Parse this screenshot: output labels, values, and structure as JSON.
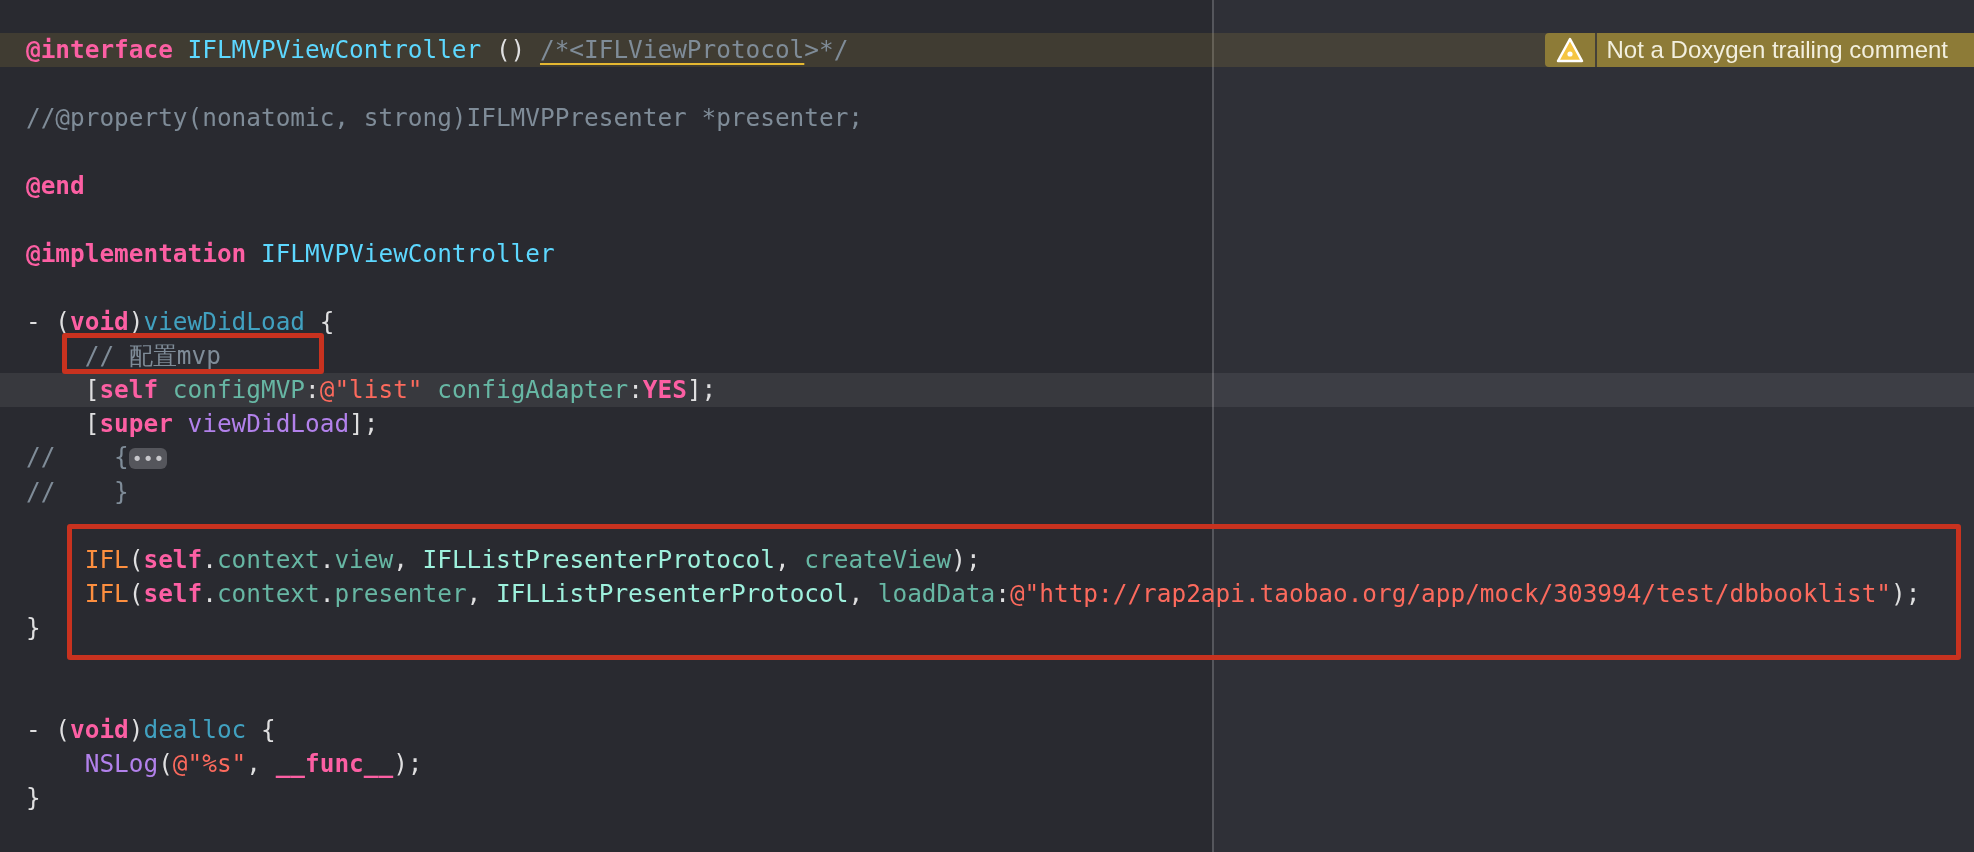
{
  "editor": {
    "lines": [
      {
        "kind": "code",
        "current": false,
        "framed": false,
        "issue": {
          "kind": "warning",
          "message": "Not a Doxygen trailing comment"
        },
        "tokens": [
          {
            "kind": "keyword",
            "text": "@interface"
          },
          {
            "kind": "class_decl",
            "text": " IFLMVPViewController"
          },
          {
            "kind": "plain",
            "text": " () "
          },
          {
            "kind": "warn_comment",
            "text": "/*<IFLViewProtocol"
          },
          {
            "kind": "comment",
            "text": ">*/"
          }
        ]
      },
      {
        "kind": "blank",
        "current": false,
        "framed": false
      },
      {
        "kind": "code",
        "current": false,
        "framed": false,
        "tokens": [
          {
            "kind": "comment",
            "text": "//@property(nonatomic, strong)IFLMVPPresenter *presenter;"
          }
        ]
      },
      {
        "kind": "blank",
        "current": false,
        "framed": false
      },
      {
        "kind": "code",
        "current": false,
        "framed": false,
        "tokens": [
          {
            "kind": "keyword",
            "text": "@end"
          }
        ]
      },
      {
        "kind": "blank",
        "current": false,
        "framed": false
      },
      {
        "kind": "code",
        "current": false,
        "framed": false,
        "tokens": [
          {
            "kind": "keyword",
            "text": "@implementation"
          },
          {
            "kind": "class_decl",
            "text": " IFLMVPViewController"
          }
        ]
      },
      {
        "kind": "blank",
        "current": false,
        "framed": false
      },
      {
        "kind": "code",
        "current": false,
        "framed": false,
        "tokens": [
          {
            "kind": "plain",
            "text": "- ("
          },
          {
            "kind": "keyword",
            "text": "void"
          },
          {
            "kind": "plain",
            "text": ")"
          },
          {
            "kind": "method_decl",
            "text": "viewDidLoad"
          },
          {
            "kind": "plain",
            "text": " {"
          }
        ]
      },
      {
        "kind": "code",
        "current": false,
        "framed": true,
        "tokens": [
          {
            "kind": "comment",
            "text": "    // 配置mvp"
          }
        ]
      },
      {
        "kind": "code",
        "current": true,
        "framed": false,
        "tokens": [
          {
            "kind": "plain",
            "text": "    ["
          },
          {
            "kind": "keyword",
            "text": "self"
          },
          {
            "kind": "method",
            "text": " configMVP"
          },
          {
            "kind": "plain",
            "text": ":"
          },
          {
            "kind": "string",
            "text": "@\"list\""
          },
          {
            "kind": "method",
            "text": " configAdapter"
          },
          {
            "kind": "plain",
            "text": ":"
          },
          {
            "kind": "keyword",
            "text": "YES"
          },
          {
            "kind": "plain",
            "text": "];"
          }
        ]
      },
      {
        "kind": "code",
        "current": false,
        "framed": false,
        "tokens": [
          {
            "kind": "plain",
            "text": "    ["
          },
          {
            "kind": "keyword",
            "text": "super"
          },
          {
            "kind": "sys_method",
            "text": " viewDidLoad"
          },
          {
            "kind": "plain",
            "text": "];"
          }
        ]
      },
      {
        "kind": "code",
        "current": false,
        "framed": false,
        "tokens": [
          {
            "kind": "comment",
            "text": "//    {"
          },
          {
            "kind": "fold",
            "text": "•••"
          }
        ]
      },
      {
        "kind": "code",
        "current": false,
        "framed": false,
        "tokens": [
          {
            "kind": "comment",
            "text": "//    }"
          }
        ]
      },
      {
        "kind": "blank",
        "current": false,
        "framed": false
      },
      {
        "kind": "code",
        "current": false,
        "framed": true,
        "tokens": [
          {
            "kind": "macro",
            "text": "    IFL"
          },
          {
            "kind": "plain",
            "text": "("
          },
          {
            "kind": "keyword",
            "text": "self"
          },
          {
            "kind": "plain",
            "text": "."
          },
          {
            "kind": "method",
            "text": "context"
          },
          {
            "kind": "plain",
            "text": "."
          },
          {
            "kind": "method",
            "text": "view"
          },
          {
            "kind": "plain",
            "text": ", "
          },
          {
            "kind": "type",
            "text": "IFLListPresenterProtocol"
          },
          {
            "kind": "plain",
            "text": ", "
          },
          {
            "kind": "method",
            "text": "createView"
          },
          {
            "kind": "plain",
            "text": ");"
          }
        ]
      },
      {
        "kind": "code",
        "current": false,
        "framed": true,
        "tokens": [
          {
            "kind": "macro",
            "text": "    IFL"
          },
          {
            "kind": "plain",
            "text": "("
          },
          {
            "kind": "keyword",
            "text": "self"
          },
          {
            "kind": "plain",
            "text": "."
          },
          {
            "kind": "method",
            "text": "context"
          },
          {
            "kind": "plain",
            "text": "."
          },
          {
            "kind": "method",
            "text": "presenter"
          },
          {
            "kind": "plain",
            "text": ", "
          },
          {
            "kind": "type",
            "text": "IFLListPresenterProtocol"
          },
          {
            "kind": "plain",
            "text": ", "
          },
          {
            "kind": "method",
            "text": "loadData"
          },
          {
            "kind": "plain",
            "text": ":"
          },
          {
            "kind": "string",
            "text": "@\"http://rap2api.taobao.org/app/mock/303994/test/dbbooklist\""
          },
          {
            "kind": "plain",
            "text": ");"
          }
        ]
      },
      {
        "kind": "code",
        "current": false,
        "framed": true,
        "tokens": [
          {
            "kind": "plain",
            "text": "}"
          }
        ]
      },
      {
        "kind": "blank",
        "current": false,
        "framed": false
      },
      {
        "kind": "blank",
        "current": false,
        "framed": false
      },
      {
        "kind": "code",
        "current": false,
        "framed": false,
        "tokens": [
          {
            "kind": "plain",
            "text": "- ("
          },
          {
            "kind": "keyword",
            "text": "void"
          },
          {
            "kind": "plain",
            "text": ")"
          },
          {
            "kind": "method_decl",
            "text": "dealloc"
          },
          {
            "kind": "plain",
            "text": " {"
          }
        ]
      },
      {
        "kind": "code",
        "current": false,
        "framed": false,
        "tokens": [
          {
            "kind": "sys_method",
            "text": "    NSLog"
          },
          {
            "kind": "plain",
            "text": "("
          },
          {
            "kind": "string",
            "text": "@\"%s\""
          },
          {
            "kind": "plain",
            "text": ", "
          },
          {
            "kind": "keyword",
            "text": "__func__"
          },
          {
            "kind": "plain",
            "text": ");"
          }
        ]
      },
      {
        "kind": "code",
        "current": false,
        "framed": false,
        "tokens": [
          {
            "kind": "plain",
            "text": "}"
          }
        ]
      }
    ]
  }
}
